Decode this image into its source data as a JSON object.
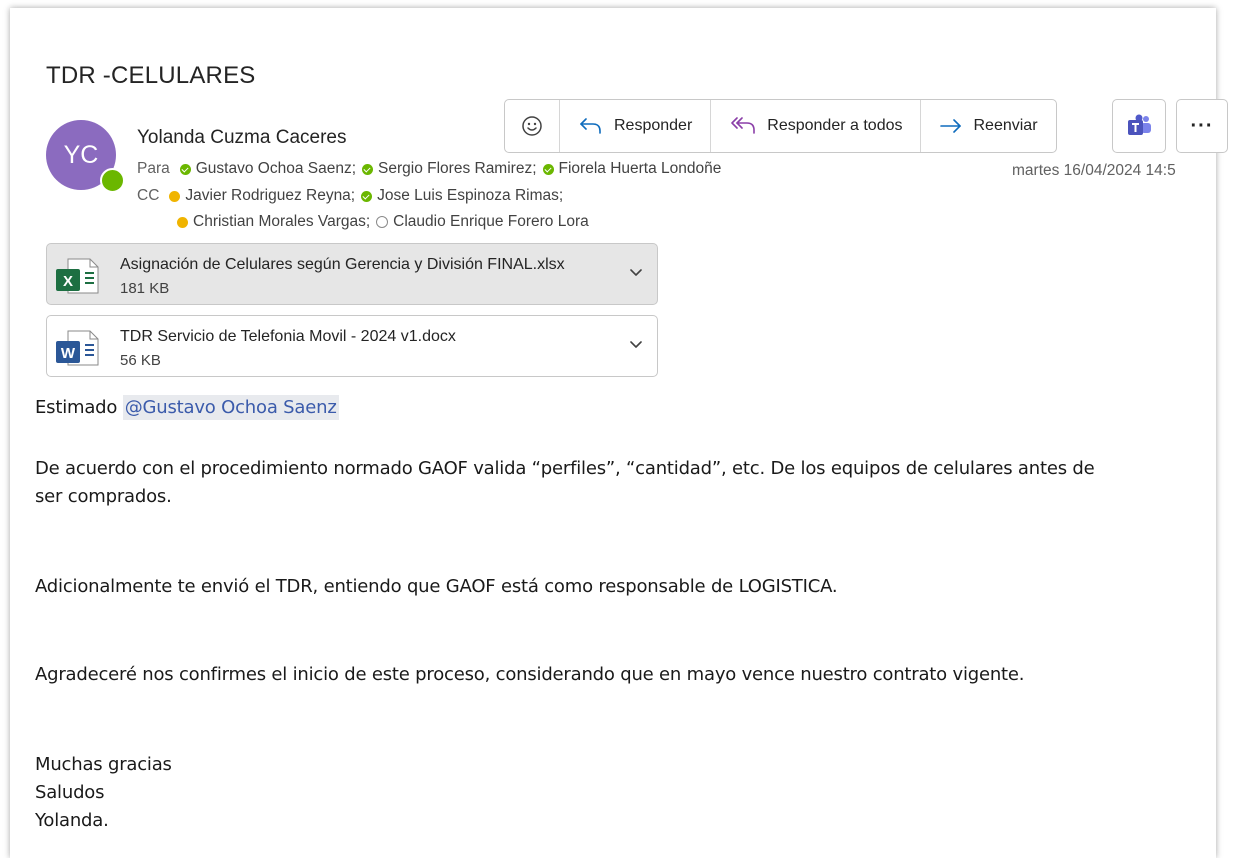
{
  "subject": "TDR -CELULARES",
  "sender": {
    "initials": "YC",
    "name": "Yolanda Cuzma Caceres",
    "avatar_color": "#8b6bbf"
  },
  "toolbar": {
    "reply": "Responder",
    "reply_all": "Responder a todos",
    "forward": "Reenviar"
  },
  "recipients": {
    "to_label": "Para",
    "to": [
      "Gustavo Ochoa Saenz;",
      "Sergio Flores Ramirez;",
      "Fiorela Huerta Londoñe"
    ],
    "cc_label": "CC",
    "cc_line1": [
      "Javier Rodriguez Reyna;",
      "Jose Luis Espinoza Rimas;"
    ],
    "cc_line2": [
      "Christian Morales Vargas;",
      "Claudio Enrique Forero Lora"
    ]
  },
  "date": "martes 16/04/2024 14:5",
  "attachments": [
    {
      "name": "Asignación de Celulares según Gerencia y División FINAL.xlsx",
      "size": "181 KB",
      "type": "excel"
    },
    {
      "name": "TDR Servicio de Telefonia Movil - 2024 v1.docx",
      "size": "56 KB",
      "type": "word"
    }
  ],
  "body": {
    "greeting": "Estimado ",
    "mention": "@Gustavo Ochoa Saenz",
    "p1_line1": "De acuerdo con el procedimiento normado GAOF valida “perfiles”, “cantidad”, etc. De los equipos de celulares antes de",
    "p1_line2": "ser comprados.",
    "p2": "Adicionalmente te envió el TDR, entiendo que GAOF está como responsable de LOGISTICA.",
    "p3": "Agradeceré nos confirmes el inicio de este proceso, considerando que en mayo vence nuestro contrato vigente.",
    "closing1": "Muchas gracias",
    "closing2": "Saludos",
    "closing3": "Yolanda."
  },
  "colors": {
    "presence_available": "#6bb700",
    "presence_away": "#f0b400",
    "excel": "#1d6f42",
    "word": "#2b5797",
    "teams": "#5059c9",
    "accent": "#0f6cbd"
  }
}
